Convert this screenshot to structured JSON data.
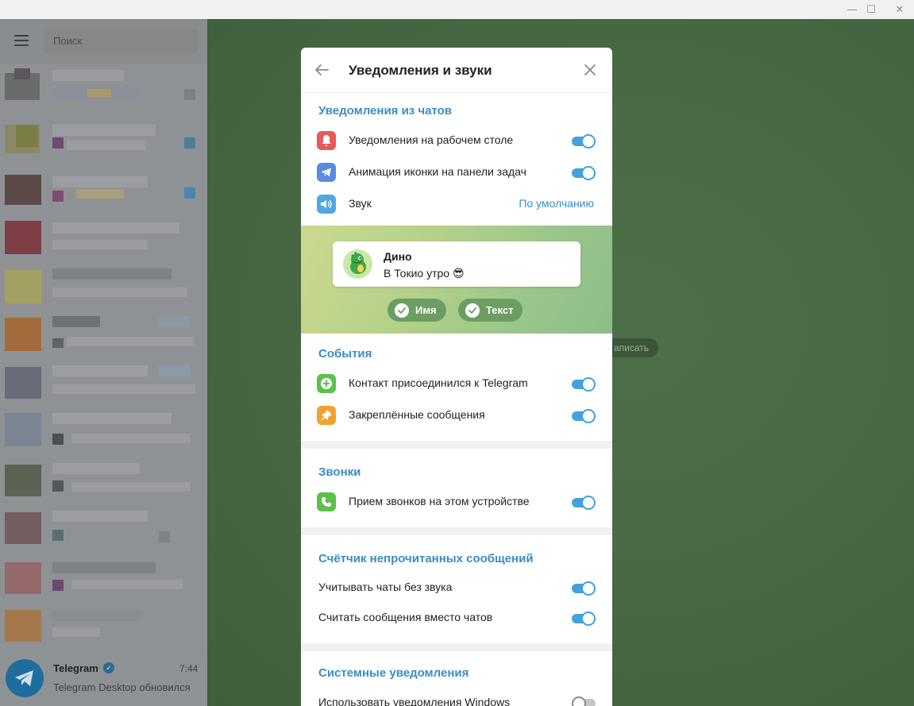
{
  "window": {
    "minimize_glyph": "—",
    "maximize_glyph": "☐",
    "close_glyph": "✕"
  },
  "sidebar": {
    "search_placeholder": "Поиск",
    "pinned_chat": {
      "name": "Telegram",
      "time": "7:44",
      "preview": "Telegram Desktop обновился"
    }
  },
  "chat_area": {
    "select_hint": "аписать"
  },
  "modal": {
    "title": "Уведомления и звуки",
    "sections": {
      "chats": {
        "title": "Уведомления из чатов",
        "desktop_notifications": "Уведомления на рабочем столе",
        "taskbar_animation": "Анимация иконки на панели задач",
        "sound_label": "Звук",
        "sound_value": "По умолчанию"
      },
      "preview": {
        "sender": "Дино",
        "message": "В Токио утро 😎",
        "chip_name": "Имя",
        "chip_text": "Текст"
      },
      "events": {
        "title": "События",
        "contact_joined": "Контакт присоединился к Telegram",
        "pinned_messages": "Закреплённые сообщения"
      },
      "calls": {
        "title": "Звонки",
        "accept_calls": "Прием звонков на этом устройстве"
      },
      "badge": {
        "title": "Счётчик непрочитанных сообщений",
        "count_muted": "Учитывать чаты без звука",
        "count_messages": "Считать сообщения вместо чатов"
      },
      "system": {
        "title": "Системные уведомления",
        "use_windows": "Использовать уведомления Windows"
      }
    },
    "toggles": {
      "desktop_notifications": true,
      "taskbar_animation": true,
      "contact_joined": true,
      "pinned_messages": true,
      "accept_calls": true,
      "count_muted": true,
      "count_messages": true,
      "use_windows": false
    }
  },
  "colors": {
    "accent": "#3a8dc6",
    "toggle_on": "#44a1dc",
    "bell_icon_bg": "#e8595a",
    "telegram_icon_bg": "#5b8be0",
    "sound_icon_bg": "#4fa8e0",
    "contact_icon_bg": "#5cc04a",
    "pin_icon_bg": "#f0a230",
    "phone_icon_bg": "#5cc04a"
  },
  "icons": {
    "menu": "hamburger-icon",
    "back": "arrow-left-icon",
    "close": "close-icon",
    "desktop": "bell-icon",
    "taskbar": "telegram-plane-icon",
    "sound": "speaker-icon",
    "contact": "plus-circle-icon",
    "pinned": "pin-icon",
    "calls": "phone-icon",
    "chip": "check-icon"
  }
}
